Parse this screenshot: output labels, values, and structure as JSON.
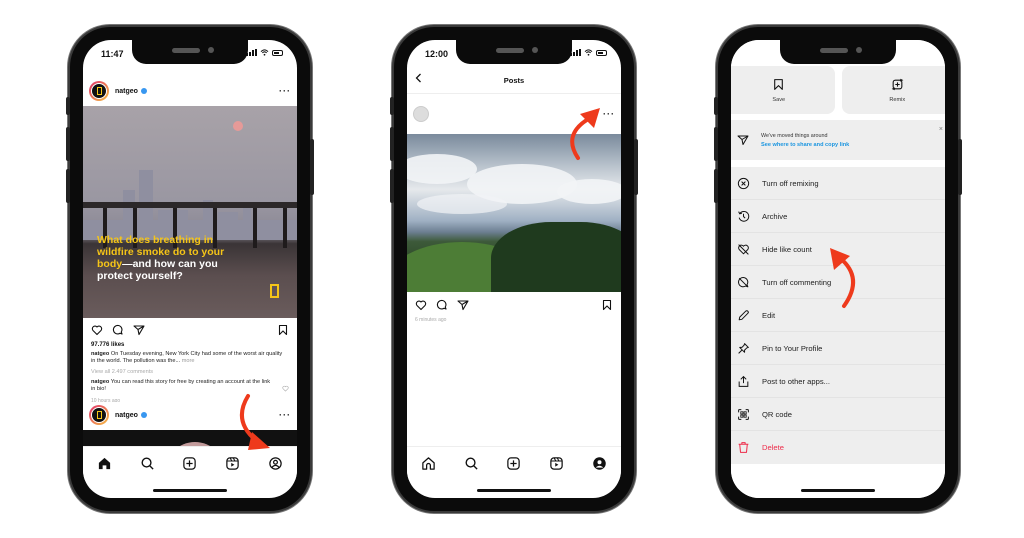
{
  "colors": {
    "accent_red": "#ee3a1c",
    "link_blue": "#1a95e0",
    "danger": "#ed2c4a",
    "natgeo_yellow": "#f5c518",
    "verified_blue": "#3897f0"
  },
  "phone1": {
    "status_time": "11:47",
    "post1": {
      "username": "natgeo",
      "headline_yellow": "What does breathing in wildfire smoke do to your body",
      "headline_white": "—and how can you protect yourself?",
      "likes": "97.776 likes",
      "caption_user": "natgeo",
      "caption_text": "On Tuesday evening, New York City had some of the worst air quality in the world. The pollution was the...",
      "caption_more": "more",
      "view_comments": "View all 2.497 comments",
      "comment_user": "natgeo",
      "comment_text": "You can read this story for free by creating an account at the link in bio!",
      "time_ago": "10 hours ago"
    },
    "post2": {
      "username": "natgeo"
    },
    "nav": [
      "home-icon",
      "search-icon",
      "new-post-icon",
      "reels-icon",
      "profile-icon"
    ]
  },
  "phone2": {
    "status_time": "12:00",
    "title": "Posts",
    "time_ago": "6 minutes ago",
    "nav": [
      "home-icon",
      "search-icon",
      "new-post-icon",
      "reels-icon",
      "profile-icon"
    ]
  },
  "phone3": {
    "tiles": [
      {
        "label": "Save",
        "icon": "bookmark-icon"
      },
      {
        "label": "Remix",
        "icon": "remix-icon"
      }
    ],
    "notice": {
      "line1": "We've moved things around",
      "line2": "See where to share and copy link",
      "close": "×"
    },
    "menu": [
      {
        "label": "Turn off remixing",
        "icon": "circle-x-icon"
      },
      {
        "label": "Archive",
        "icon": "archive-icon"
      },
      {
        "label": "Hide like count",
        "icon": "heart-off-icon"
      },
      {
        "label": "Turn off commenting",
        "icon": "comment-off-icon"
      },
      {
        "label": "Edit",
        "icon": "pencil-icon"
      },
      {
        "label": "Pin to Your Profile",
        "icon": "pin-icon"
      },
      {
        "label": "Post to other apps...",
        "icon": "share-icon"
      },
      {
        "label": "QR code",
        "icon": "qr-code-icon"
      },
      {
        "label": "Delete",
        "icon": "trash-icon",
        "danger": true
      }
    ]
  }
}
